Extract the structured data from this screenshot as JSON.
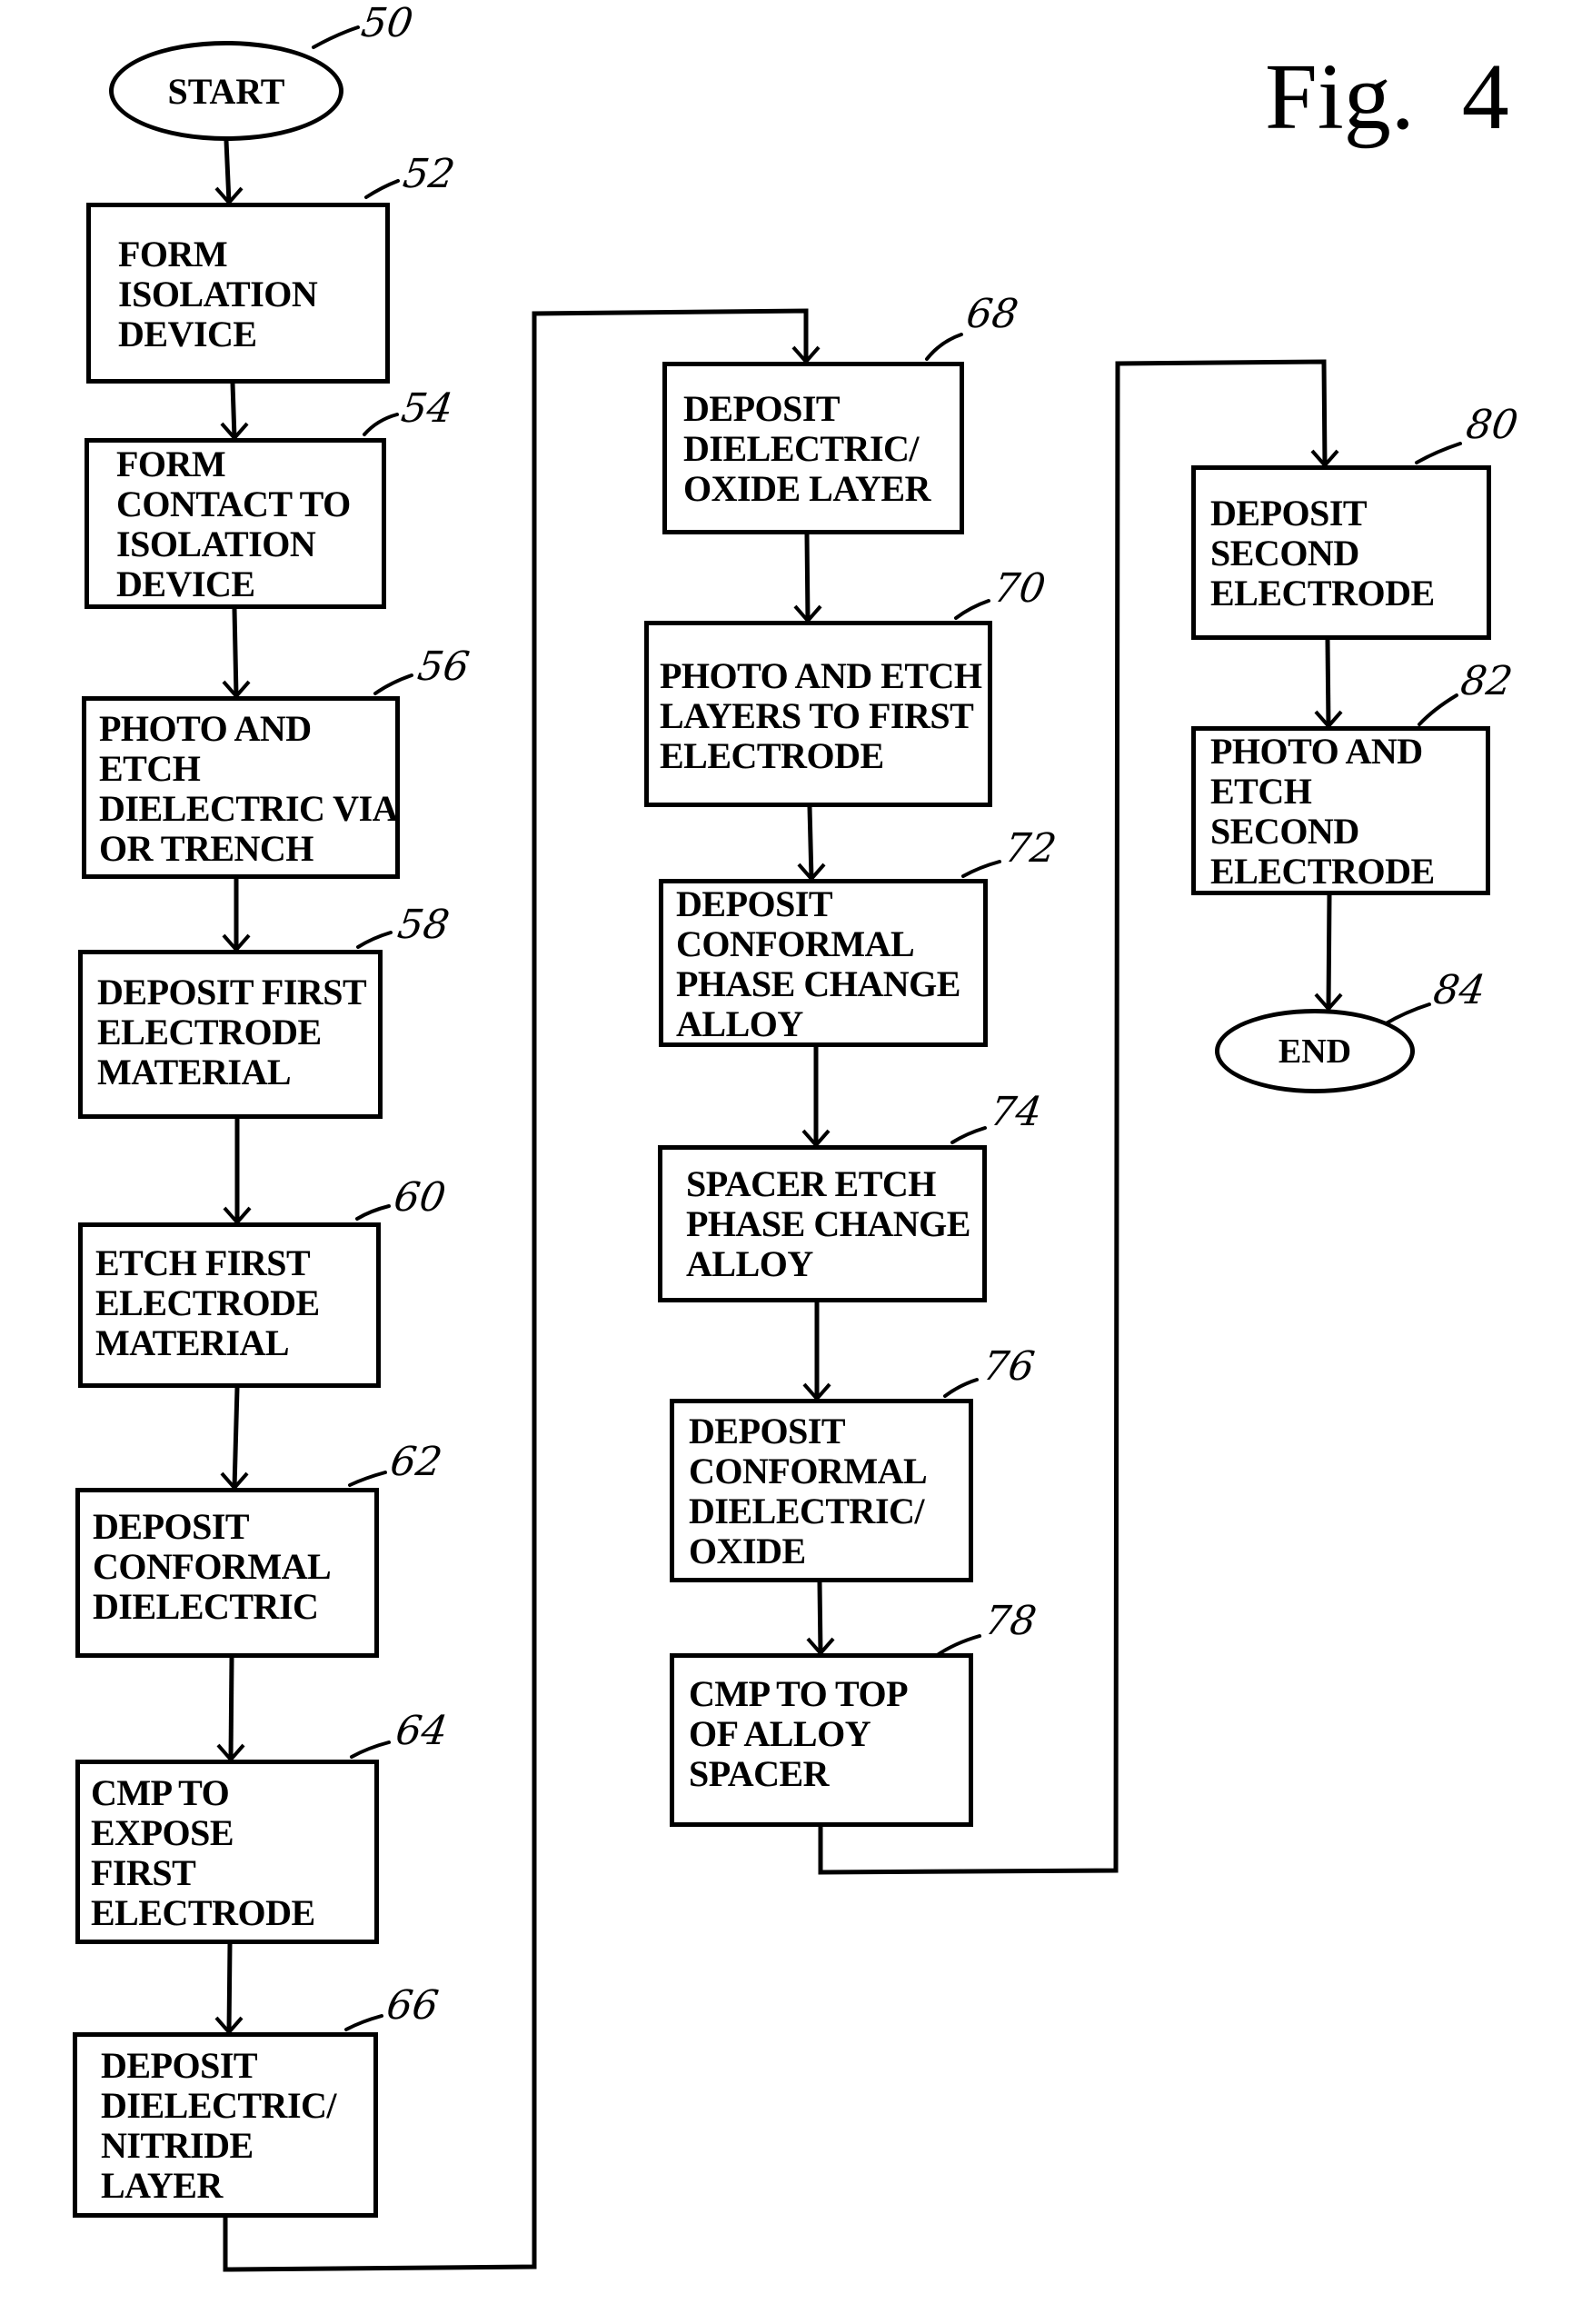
{
  "figure": {
    "title": "Fig.  4",
    "type": "process flowchart"
  },
  "terminals": {
    "start": {
      "ref": "50",
      "label": "START"
    },
    "end": {
      "ref": "84",
      "label": "END"
    }
  },
  "steps": [
    {
      "ref": "52",
      "lines": [
        "FORM",
        "ISOLATION",
        "DEVICE"
      ]
    },
    {
      "ref": "54",
      "lines": [
        "FORM",
        "CONTACT TO",
        "ISOLATION",
        "DEVICE"
      ]
    },
    {
      "ref": "56",
      "lines": [
        "PHOTO AND",
        "ETCH",
        "DIELECTRIC VIA",
        "OR TRENCH"
      ]
    },
    {
      "ref": "58",
      "lines": [
        "DEPOSIT FIRST",
        "ELECTRODE",
        "MATERIAL"
      ]
    },
    {
      "ref": "60",
      "lines": [
        "ETCH FIRST",
        "ELECTRODE",
        "MATERIAL"
      ]
    },
    {
      "ref": "62",
      "lines": [
        "DEPOSIT",
        "CONFORMAL",
        "DIELECTRIC"
      ]
    },
    {
      "ref": "64",
      "lines": [
        "CMP TO",
        "EXPOSE",
        "FIRST",
        "ELECTRODE"
      ]
    },
    {
      "ref": "66",
      "lines": [
        "DEPOSIT",
        "DIELECTRIC/",
        "NITRIDE",
        "LAYER"
      ]
    },
    {
      "ref": "68",
      "lines": [
        "DEPOSIT",
        "DIELECTRIC/",
        "OXIDE LAYER"
      ]
    },
    {
      "ref": "70",
      "lines": [
        "PHOTO AND ETCH",
        "LAYERS TO FIRST",
        "ELECTRODE"
      ]
    },
    {
      "ref": "72",
      "lines": [
        "DEPOSIT",
        "CONFORMAL",
        "PHASE CHANGE",
        "ALLOY"
      ]
    },
    {
      "ref": "74",
      "lines": [
        "SPACER ETCH",
        "PHASE CHANGE",
        "ALLOY"
      ]
    },
    {
      "ref": "76",
      "lines": [
        "DEPOSIT",
        "CONFORMAL",
        "DIELECTRIC/",
        "OXIDE"
      ]
    },
    {
      "ref": "78",
      "lines": [
        "CMP TO TOP",
        "OF ALLOY",
        "SPACER"
      ]
    },
    {
      "ref": "80",
      "lines": [
        "DEPOSIT",
        "SECOND",
        "ELECTRODE"
      ]
    },
    {
      "ref": "82",
      "lines": [
        "PHOTO AND",
        "ETCH",
        "SECOND",
        "ELECTRODE"
      ]
    }
  ],
  "flow_order": [
    "50",
    "52",
    "54",
    "56",
    "58",
    "60",
    "62",
    "64",
    "66",
    "68",
    "70",
    "72",
    "74",
    "76",
    "78",
    "80",
    "82",
    "84"
  ],
  "colors": {
    "ink": "#000000",
    "paper": "#ffffff"
  }
}
